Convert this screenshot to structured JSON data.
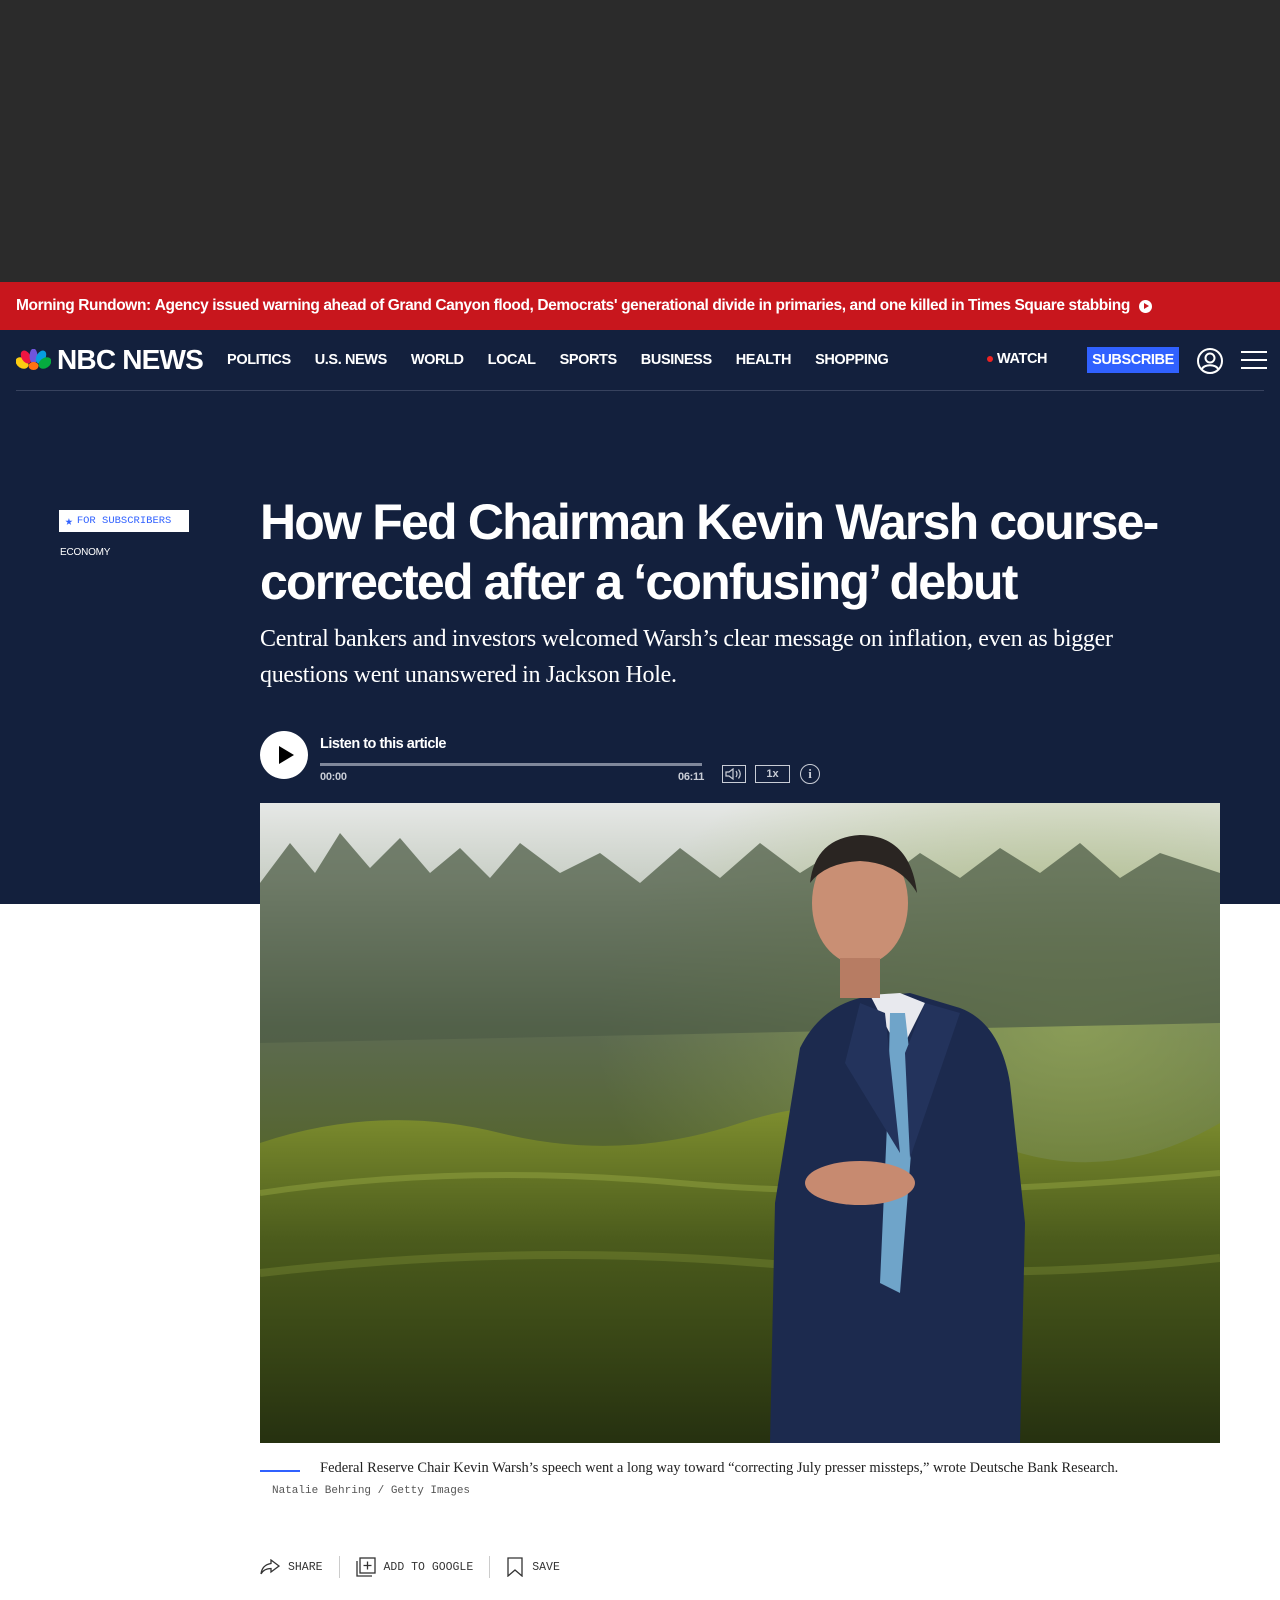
{
  "alert": {
    "label": "Morning Rundown:",
    "text": "Agency issued warning ahead of Grand Canyon flood, Democrats' generational divide in primaries, and one killed in Times Square stabbing"
  },
  "header": {
    "logo": "NBC NEWS",
    "nav": [
      "POLITICS",
      "U.S. NEWS",
      "WORLD",
      "LOCAL",
      "SPORTS",
      "BUSINESS",
      "HEALTH",
      "SHOPPING"
    ],
    "watch": "WATCH",
    "subscribe": "SUBSCRIBE"
  },
  "article": {
    "badge": "FOR SUBSCRIBERS",
    "category": "ECONOMY",
    "headline": "How Fed Chairman Kevin Warsh course-corrected after a ‘confusing’ debut",
    "dek": "Central bankers and investors welcomed Warsh’s clear message on inflation, even as bigger questions went unanswered in Jackson Hole.",
    "caption": "Federal Reserve Chair Kevin Warsh’s speech went a long way toward “correcting July presser missteps,” wrote Deutsche Bank Research.",
    "credit": "Natalie Behring / Getty Images"
  },
  "player": {
    "label": "Listen to this article",
    "current": "00:00",
    "total": "06:11",
    "speed": "1x",
    "progress": 0.0
  },
  "actions": {
    "share": "SHARE",
    "google": "ADD TO GOOGLE",
    "save": "SAVE"
  },
  "colors": {
    "alert_bg": "#c8161d",
    "hero_bg": "#13203d",
    "accent": "#3061ff"
  }
}
